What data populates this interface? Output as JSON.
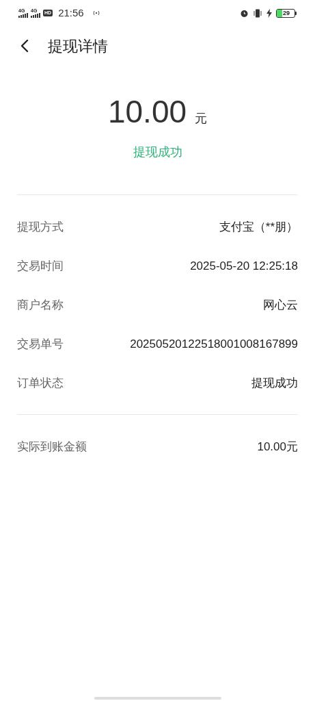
{
  "status_bar": {
    "signal_1": "4G",
    "signal_2": "4G",
    "hd": "HD",
    "time": "21:56",
    "battery": "29"
  },
  "header": {
    "title": "提现详情"
  },
  "amount": {
    "value": "10.00",
    "unit": "元",
    "status": "提现成功"
  },
  "details": [
    {
      "label": "提现方式",
      "value": "支付宝（**朋）"
    },
    {
      "label": "交易时间",
      "value": "2025-05-20 12:25:18"
    },
    {
      "label": "商户名称",
      "value": "网心云"
    },
    {
      "label": "交易单号",
      "value": "20250520122518001008167899"
    },
    {
      "label": "订单状态",
      "value": "提现成功"
    }
  ],
  "total": {
    "label": "实际到账金额",
    "value": "10.00元"
  }
}
